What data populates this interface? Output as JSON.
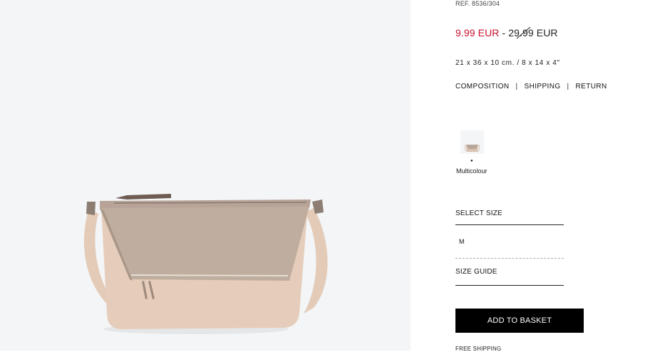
{
  "product": {
    "reference": "REF. 8536/304",
    "sale_price": "9.99 EUR",
    "price_separator": " - ",
    "original_price": "29.99 EUR",
    "dimensions": "21 x 36 x 10 cm. / 8 x 14 x 4\"",
    "color_label": "Multicolour",
    "colors": {
      "sale": "#c8102e",
      "bag": "#cdb7a7",
      "button": "#000000"
    }
  },
  "info_links": [
    "COMPOSITION",
    "SHIPPING",
    "RETURN"
  ],
  "size": {
    "label": "SELECT SIZE",
    "selected": "M",
    "guide_label": "SIZE GUIDE"
  },
  "actions": {
    "add_to_basket": "ADD TO BASKET",
    "free_shipping": "FREE SHIPPING"
  },
  "icons": [
    "bag-thumbnail-icon",
    "selected-dot-icon"
  ]
}
